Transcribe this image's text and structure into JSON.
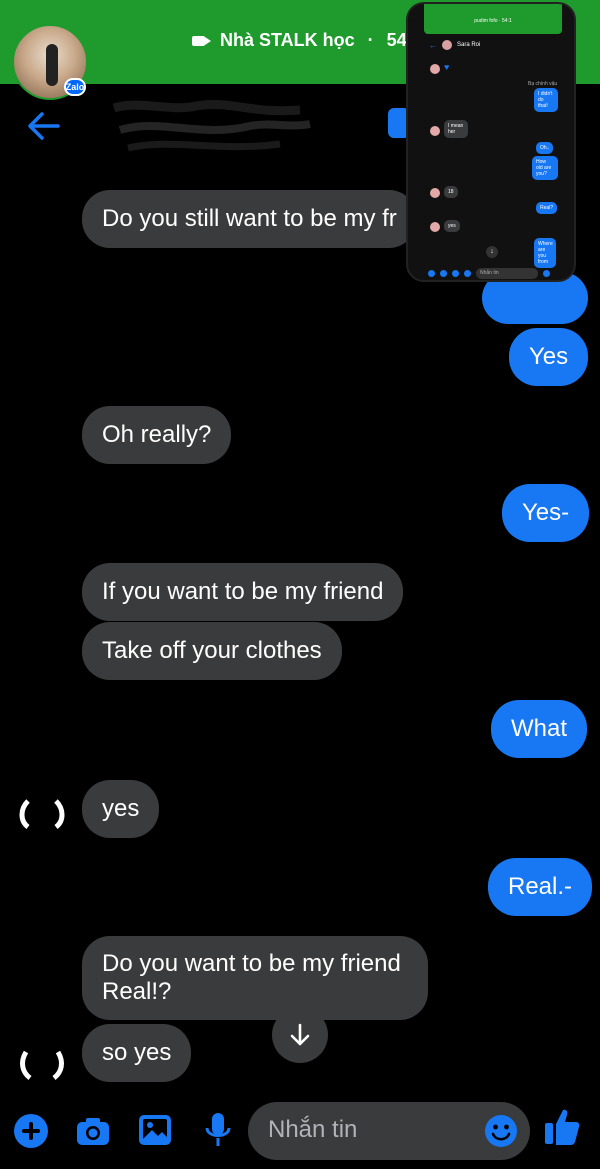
{
  "status": {
    "call_title": "Nhà STALK học",
    "call_sep": " · ",
    "call_timer": "54:1"
  },
  "zalo_badge": "Zalo",
  "messages": [
    {
      "side": "in",
      "text": "Do you still want to be my fr"
    },
    {
      "side": "out",
      "text": "Yes"
    },
    {
      "side": "in",
      "text": "Oh really?"
    },
    {
      "side": "out",
      "text": "Yes-"
    },
    {
      "side": "in",
      "text": "If you want to be my friend"
    },
    {
      "side": "in",
      "text": "Take off your clothes"
    },
    {
      "side": "out",
      "text": "What"
    },
    {
      "side": "in",
      "text": "yes"
    },
    {
      "side": "out",
      "text": "Real.-"
    },
    {
      "side": "in",
      "text": "Do you want to be my friend\nReal!?"
    },
    {
      "side": "in",
      "text": "so yes"
    }
  ],
  "pip": {
    "time": "pudim fofo · 54:1",
    "contact_name": "Sara Roi",
    "bubbles": {
      "b1": "Bạ chính vậu",
      "b2": "I didn't do that!",
      "b3": "I mean her",
      "b4": "Oh..",
      "b5": "How old are you?",
      "b6": "18",
      "b7": "Real?",
      "b8": "yes",
      "b9": "Where are you from"
    },
    "placeholder": "Nhắn tin"
  },
  "composer": {
    "placeholder": "Nhắn tin"
  },
  "colors": {
    "accent": "#1877f2",
    "incoming_bubble": "#3a3b3c",
    "call_bar": "#1f9a2c",
    "background": "#000000"
  }
}
